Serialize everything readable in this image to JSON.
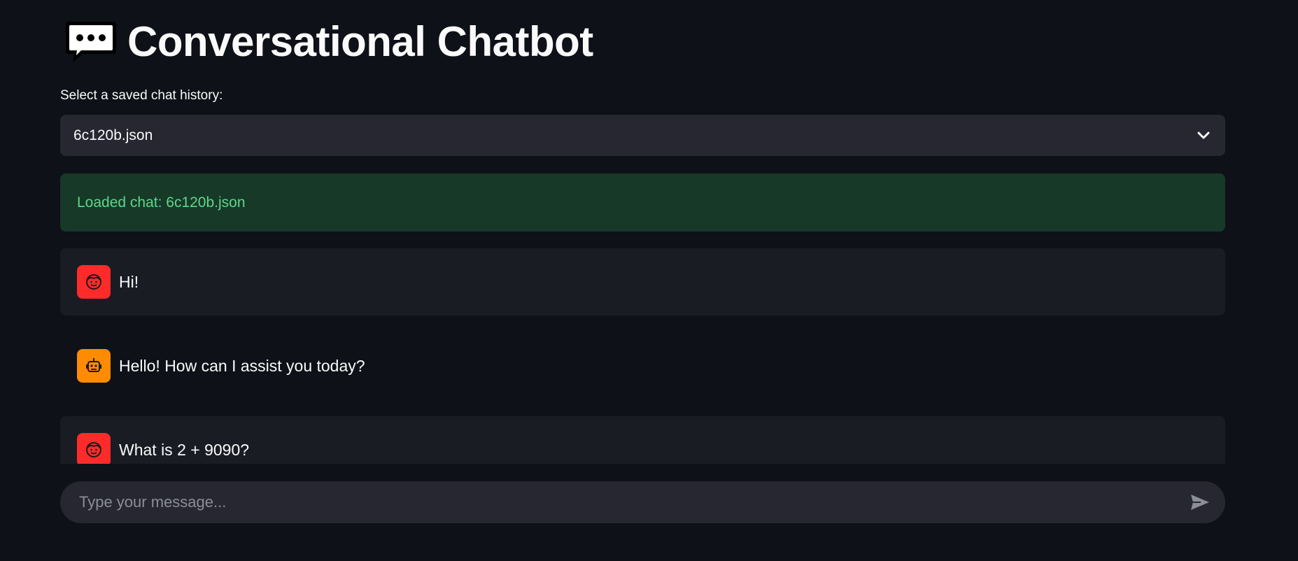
{
  "header": {
    "title": "Conversational Chatbot",
    "icon": "speech-balloon-icon"
  },
  "history_select": {
    "label": "Select a saved chat history:",
    "selected_value": "6c120b.json"
  },
  "status": {
    "message": "Loaded chat: 6c120b.json",
    "color": "#5fd68a"
  },
  "messages": [
    {
      "role": "user",
      "avatar": "user-face-icon",
      "text": "Hi!"
    },
    {
      "role": "assistant",
      "avatar": "robot-icon",
      "text": "Hello! How can I assist you today?"
    },
    {
      "role": "user",
      "avatar": "user-face-icon",
      "text": "What is 2 + 9090?"
    }
  ],
  "chat_input": {
    "placeholder": "Type your message...",
    "value": ""
  },
  "colors": {
    "background": "#0e1117",
    "user_avatar": "#ff2b2b",
    "assistant_avatar": "#ff8c00",
    "success_bg": "#173928"
  }
}
